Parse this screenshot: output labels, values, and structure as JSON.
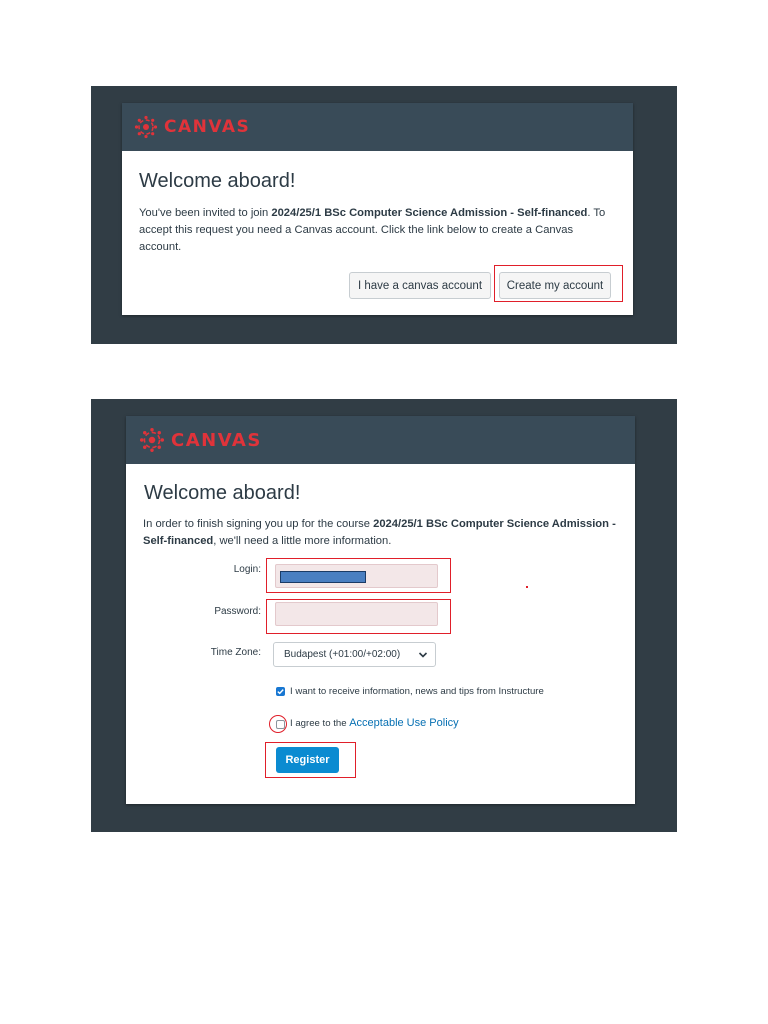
{
  "screen1": {
    "logo_text": "CANVAS",
    "title": "Welcome aboard!",
    "message_part1": "You've been invited to join ",
    "course_name": "2024/25/1 BSc Computer Science Admission - Self-financed",
    "message_part2": ". To accept this request you need a Canvas account. Click the link below to create a Canvas account.",
    "have_account_label": "I have a canvas account",
    "create_account_label": "Create my account"
  },
  "screen2": {
    "logo_text": "CANVAS",
    "title": "Welcome aboard!",
    "message_part1": "In order to finish signing you up for the course ",
    "course_name": "2024/25/1 BSc Computer Science Admission - Self-financed",
    "message_part2": ", we'll need a little more information.",
    "login_label": "Login:",
    "password_label": "Password:",
    "timezone_label": "Time Zone:",
    "timezone_value": "Budapest (+01:00/+02:00)",
    "newsletter_checked": true,
    "newsletter_label": "I want to receive information, news and tips from Instructure",
    "policy_checked": false,
    "policy_prefix": "I agree to the ",
    "policy_link": "Acceptable Use Policy",
    "register_label": "Register"
  },
  "colors": {
    "panel_bg": "#313d45",
    "header_bg": "#394b58",
    "brand_red": "#e0333a",
    "highlight_red": "#e01f2a",
    "link_blue": "#0770b3",
    "button_blue": "#0b8bd1",
    "redacted_fill": "#4a7fc1"
  },
  "icons": {
    "logo": "canvas-logo-icon",
    "dropdown": "chevron-down-icon",
    "check": "checkmark-icon"
  }
}
